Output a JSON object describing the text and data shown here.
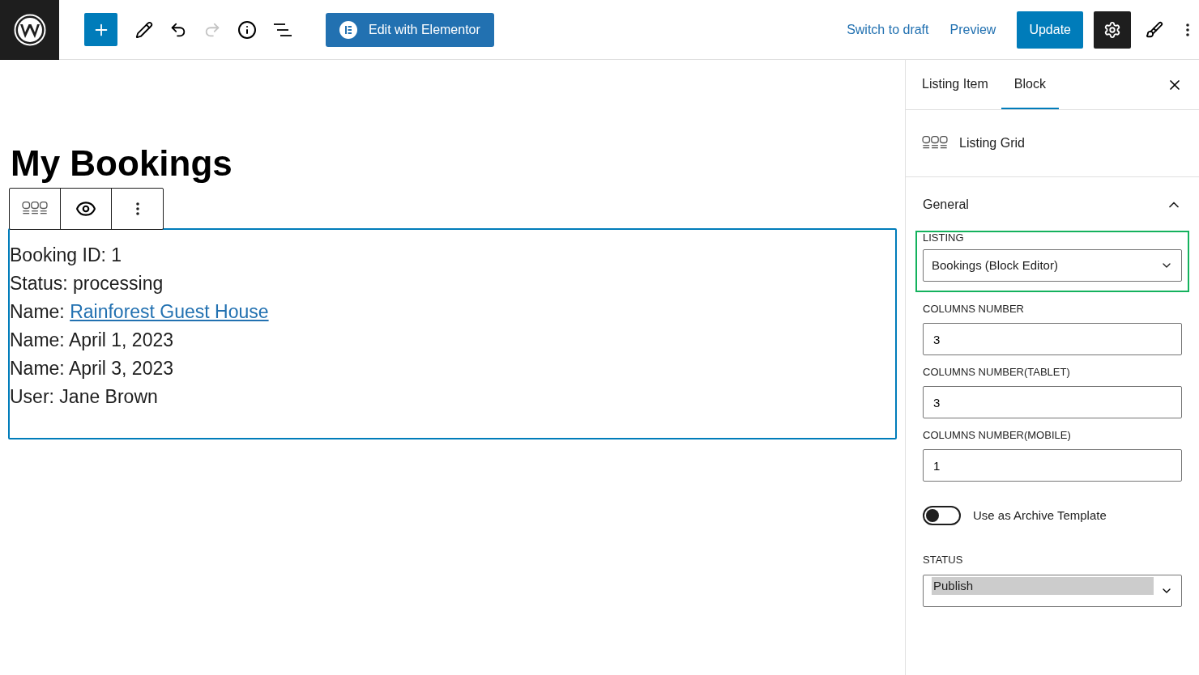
{
  "toolbar": {
    "elementor_button": "Edit with Elementor",
    "redo_disabled": true,
    "links": [
      "Switch to draft",
      "Preview"
    ],
    "update_button": "Update",
    "settings_active": true
  },
  "content": {
    "title": "My Bookings",
    "lines": [
      {
        "label": "Booking ID:",
        "value": "1",
        "kind": "text"
      },
      {
        "label": "Status:",
        "value": "processing",
        "kind": "text"
      },
      {
        "label": "Name:",
        "value": "Rainforest Guest House",
        "kind": "link"
      },
      {
        "label": "Name:",
        "value": "April 1, 2023",
        "kind": "text"
      },
      {
        "label": "Name:",
        "value": "April 3, 2023",
        "kind": "text"
      },
      {
        "label": "User:",
        "value": "Jane Brown",
        "kind": "text"
      }
    ]
  },
  "sidebar": {
    "tabs": [
      {
        "label": "Listing Item",
        "selected": false
      },
      {
        "label": "Block",
        "selected": true
      }
    ],
    "block_name": "Listing Grid",
    "panel": {
      "title": "General",
      "expanded": true
    },
    "fields": [
      {
        "kind": "select",
        "label": "LISTING",
        "value": "Bookings (Block Editor)",
        "highlighted": true
      },
      {
        "kind": "input",
        "label": "COLUMNS NUMBER",
        "value": "3"
      },
      {
        "kind": "input",
        "label": "COLUMNS NUMBER(TABLET)",
        "value": "3"
      },
      {
        "kind": "input",
        "label": "COLUMNS NUMBER(MOBILE)",
        "value": "1"
      },
      {
        "kind": "toggle",
        "label": "Use as Archive Template",
        "on": false
      },
      {
        "kind": "listbox",
        "label": "STATUS",
        "options": [
          {
            "label": "Publish",
            "selected": true
          }
        ]
      }
    ]
  }
}
